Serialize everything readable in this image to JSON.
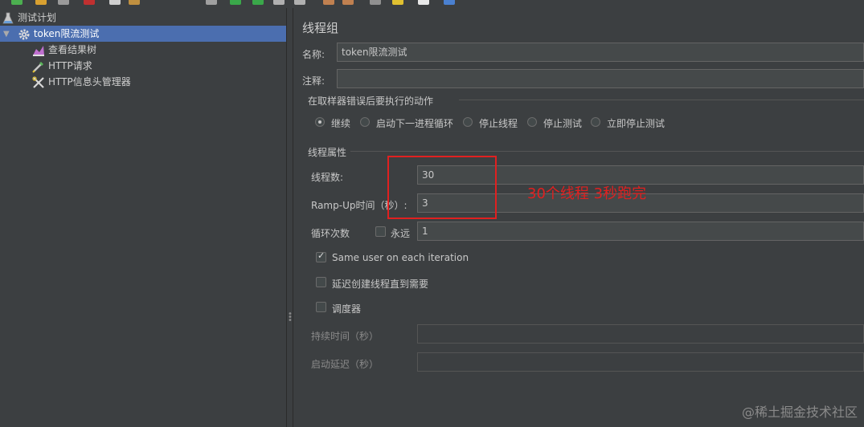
{
  "tree": {
    "plan_label": "测试计划",
    "thread_group_label": "token限流测试",
    "children": [
      {
        "label": "查看结果树",
        "icon": "result-tree-icon"
      },
      {
        "label": "HTTP请求",
        "icon": "http-sampler-icon"
      },
      {
        "label": "HTTP信息头管理器",
        "icon": "header-manager-icon"
      }
    ]
  },
  "panel": {
    "title": "线程组",
    "name_label": "名称:",
    "name_value": "token限流测试",
    "comment_label": "注释:",
    "comment_value": "",
    "error_section_title": "在取样器错误后要执行的动作",
    "error_actions": [
      {
        "label": "继续",
        "selected": true
      },
      {
        "label": "启动下一进程循环",
        "selected": false
      },
      {
        "label": "停止线程",
        "selected": false
      },
      {
        "label": "停止测试",
        "selected": false
      },
      {
        "label": "立即停止测试",
        "selected": false
      }
    ],
    "thread_props_title": "线程属性",
    "threads_label": "线程数:",
    "threads_value": "30",
    "rampup_label": "Ramp-Up时间（秒）:",
    "rampup_value": "3",
    "loop_label": "循环次数",
    "forever_label": "永远",
    "forever_checked": false,
    "loop_value": "1",
    "same_user_label": "Same user on each iteration",
    "same_user_checked": true,
    "delay_create_label": "延迟创建线程直到需要",
    "delay_create_checked": false,
    "scheduler_label": "调度器",
    "scheduler_checked": false,
    "duration_label": "持续时间（秒）",
    "duration_value": "",
    "startup_delay_label": "启动延迟（秒）",
    "startup_delay_value": ""
  },
  "annotation": {
    "text": "30个线程 3秒跑完",
    "color": "#e02020"
  },
  "watermark": "@稀土掘金技术社区"
}
